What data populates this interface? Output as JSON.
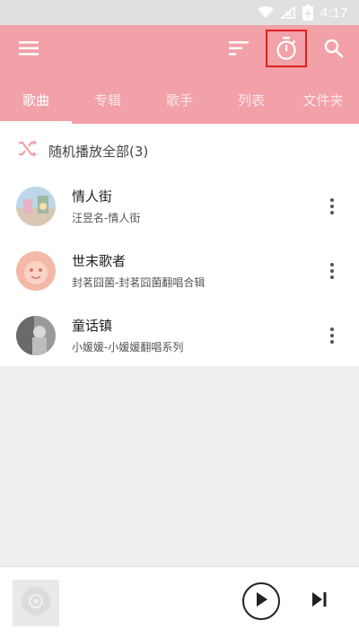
{
  "status_bar": {
    "time": "4:17",
    "icons": [
      "wifi-icon",
      "no-signal-icon",
      "battery-charging-icon"
    ]
  },
  "app_bar": {
    "menu_icon": "hamburger-icon",
    "sort_icon": "sort-icon",
    "timer_icon": "stopwatch-icon",
    "search_icon": "search-icon",
    "accent_color": "#f1a1a7",
    "highlight_color": "#e02020"
  },
  "tabs": [
    {
      "label": "歌曲",
      "active": true
    },
    {
      "label": "专辑",
      "active": false
    },
    {
      "label": "歌手",
      "active": false
    },
    {
      "label": "列表",
      "active": false
    },
    {
      "label": "文件夹",
      "active": false
    }
  ],
  "shuffle": {
    "icon": "shuffle-icon",
    "label": "随机播放全部(3)"
  },
  "songs": [
    {
      "title": "情人街",
      "subtitle": "汪昱名-情人街"
    },
    {
      "title": "世末歌者",
      "subtitle": "封茗囧菌-封茗囧菌翻唱合辑"
    },
    {
      "title": "童话镇",
      "subtitle": "小媛媛-小媛媛翻唱系列"
    }
  ],
  "player": {
    "art_icon": "disc-icon",
    "play_icon": "play-icon",
    "next_icon": "skip-next-icon"
  }
}
